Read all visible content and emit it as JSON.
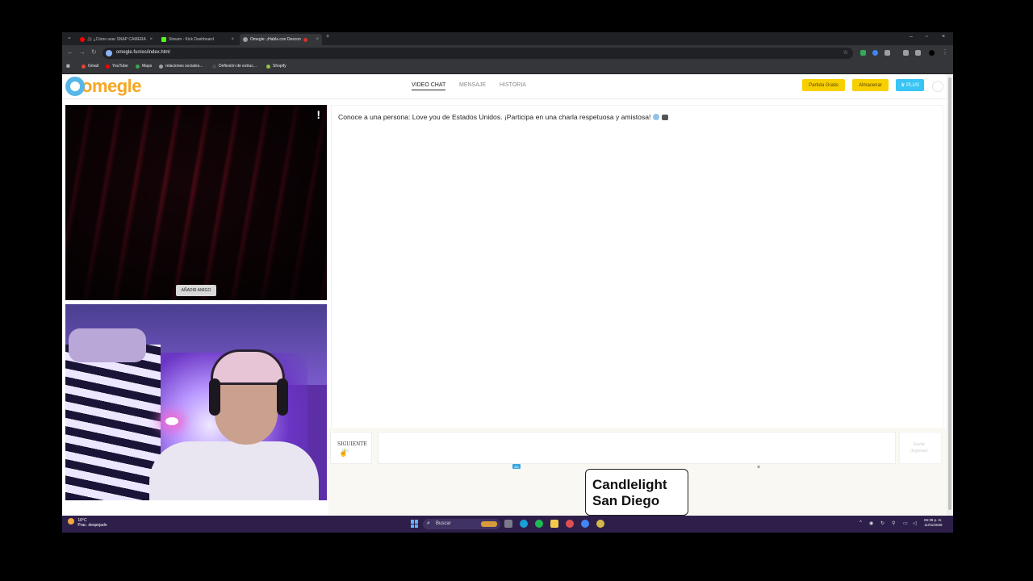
{
  "browser": {
    "tabs": [
      {
        "title": "🎥 ¿Cómo usar SNAP CAMERA",
        "icon": "youtube-icon",
        "color": "#ff0000"
      },
      {
        "title": "Stream - Kick Dashboard",
        "icon": "kick-icon",
        "color": "#53fc18"
      },
      {
        "title": "Omegle: ¡Habla con Descon",
        "icon": "omegle-icon",
        "color": "#9aa0a6"
      }
    ],
    "url": "omegle.fun/es/index.html",
    "bookmarks": [
      {
        "label": "Gmail",
        "color": "#ea4335"
      },
      {
        "label": "YouTube",
        "color": "#ff0000"
      },
      {
        "label": "Maps",
        "color": "#34a853"
      },
      {
        "label": "relaciones sociales...",
        "color": "#9aa0a6"
      },
      {
        "label": "Deflexión de estruc...",
        "color": "#4d4d4d"
      },
      {
        "label": "Shopify",
        "color": "#95bf47"
      }
    ]
  },
  "site": {
    "logo_text": "omegle",
    "nav": [
      "VIDEO CHAT",
      "MENSAJE",
      "HISTORIA"
    ],
    "buttons": {
      "free_game": "Partida Gratis",
      "store": "Almacenar",
      "plus": "♛ PLUS"
    }
  },
  "video": {
    "report_icon": "!",
    "add_friend": "AÑADIR AMIGO"
  },
  "chat": {
    "message": "Conoce a una persona: Love you de Estados Unidos. ¡Participa en una charla respetuosa y amistosa!",
    "next_label": "SIGUIENTE",
    "next_hint": "Esc",
    "send_label_1": "Enviar",
    "send_label_2": "(Ingresar)"
  },
  "ad": {
    "tag": "AD",
    "close": "×",
    "line1": "Candlelight",
    "line2": "San Diego"
  },
  "taskbar": {
    "temp": "18°C",
    "weather": "Prac. despejado",
    "search": "Buscar",
    "time": "06:39 p. m.",
    "date": "11/01/2026"
  }
}
